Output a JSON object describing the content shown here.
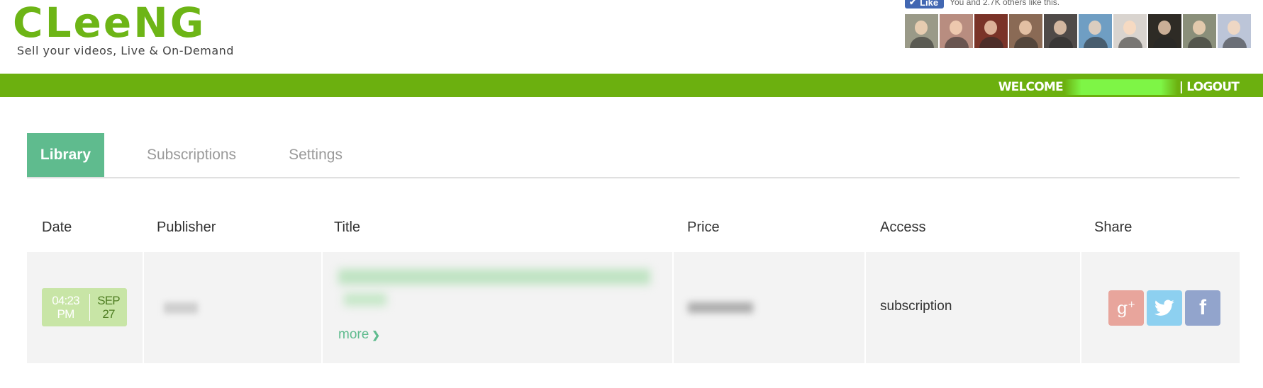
{
  "brand": {
    "logo_text": "CLeeNG",
    "tagline": "Sell your videos, Live & On-Demand",
    "color": "#6db516"
  },
  "facebook": {
    "like_label": "Like",
    "like_text": "You and 2.7K others like this.",
    "faces": [
      {
        "name": "face-1",
        "bg": "#9a9a88"
      },
      {
        "name": "face-2",
        "bg": "#b88d80"
      },
      {
        "name": "face-3",
        "bg": "#7a3328"
      },
      {
        "name": "face-4",
        "bg": "#8a6a55"
      },
      {
        "name": "face-5",
        "bg": "#4f4a48"
      },
      {
        "name": "face-6",
        "bg": "#6f9ec3"
      },
      {
        "name": "face-7",
        "bg": "#d9d4cf"
      },
      {
        "name": "face-8",
        "bg": "#2e2b25"
      },
      {
        "name": "face-9",
        "bg": "#8a8f7a"
      },
      {
        "name": "face-10",
        "bg": "#bcc5d8"
      }
    ]
  },
  "topbar": {
    "welcome_label": "WELCOME",
    "logout_label": "| LOGOUT",
    "color": "#6cb00f"
  },
  "tabs": [
    {
      "label": "Library",
      "active": true
    },
    {
      "label": "Subscriptions",
      "active": false
    },
    {
      "label": "Settings",
      "active": false
    }
  ],
  "table": {
    "headers": {
      "date": "Date",
      "publisher": "Publisher",
      "title": "Title",
      "price": "Price",
      "access": "Access",
      "share": "Share"
    },
    "rows": [
      {
        "time": "04:23",
        "ampm": "PM",
        "month": "SEP",
        "day": "27",
        "more_label": "more",
        "access": "subscription"
      }
    ]
  },
  "share_icons": [
    "google-plus-icon",
    "twitter-icon",
    "facebook-icon"
  ],
  "colors": {
    "tab_active": "#5fbb8e",
    "row_bg": "#f3f3f3",
    "date_badge": "#c8e5a6",
    "gplus": "#e8a59c",
    "twitter": "#8dd0f0",
    "facebook": "#92a4cc"
  }
}
